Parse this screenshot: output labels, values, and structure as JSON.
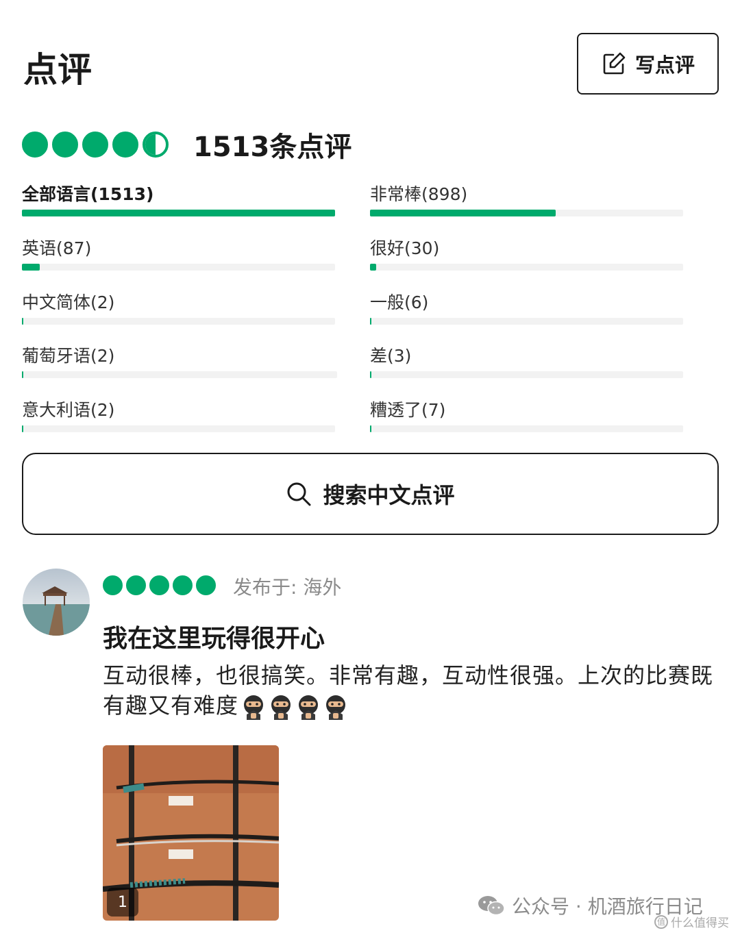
{
  "header": {
    "title": "点评",
    "write_label": "写点评"
  },
  "summary": {
    "rating": 4.5,
    "max_rating": 5,
    "count_label": "1513条点评"
  },
  "language_filters": [
    {
      "label": "全部语言(1513)",
      "count": 1513,
      "share": 1.0,
      "selected": true
    },
    {
      "label": "英语(87)",
      "count": 87,
      "share": 0.057
    },
    {
      "label": "中文简体(2)",
      "count": 2,
      "share": 0.001
    },
    {
      "label": "葡萄牙语(2)",
      "count": 2,
      "share": 0.001
    },
    {
      "label": "意大利语(2)",
      "count": 2,
      "share": 0.001
    }
  ],
  "rating_filters": [
    {
      "label": "非常棒(898)",
      "count": 898,
      "share": 0.593
    },
    {
      "label": "很好(30)",
      "count": 30,
      "share": 0.02
    },
    {
      "label": "一般(6)",
      "count": 6,
      "share": 0.004
    },
    {
      "label": "差(3)",
      "count": 3,
      "share": 0.002
    },
    {
      "label": "糟透了(7)",
      "count": 7,
      "share": 0.005
    }
  ],
  "search": {
    "label": "搜索中文点评"
  },
  "review": {
    "rating": 5,
    "posted": "发布于: 海外",
    "title": "我在这里玩得很开心",
    "body": "互动很棒，也很搞笑。非常有趣，互动性很强。上次的比赛既有趣又有难度",
    "emoji": [
      "ninja-icon",
      "ninja-icon",
      "ninja-icon",
      "ninja-icon"
    ],
    "photo_count": "1"
  },
  "watermark": {
    "text": "公众号 · 机酒旅行日记",
    "site": "什么值得买"
  },
  "colors": {
    "accent": "#00aa6c",
    "track": "#f2f2f2",
    "text": "#1a1a1a",
    "muted": "#8a8a8a"
  }
}
